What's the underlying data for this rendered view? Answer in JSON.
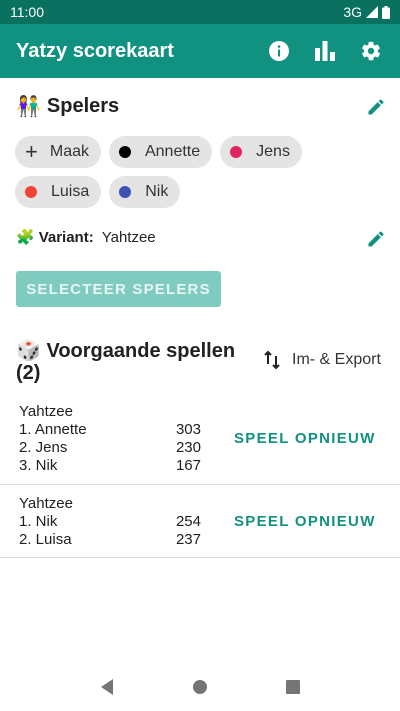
{
  "status": {
    "time": "11:00",
    "network": "3G"
  },
  "app_bar": {
    "title": "Yatzy scorekaart",
    "icons": [
      "info-icon",
      "bar-chart-icon",
      "settings-icon"
    ]
  },
  "players_section": {
    "emoji": "👫",
    "title": "Spelers",
    "add_label": "Maak",
    "players": [
      {
        "name": "Annette",
        "color": "#000000"
      },
      {
        "name": "Jens",
        "color": "#e0245e"
      },
      {
        "name": "Luisa",
        "color": "#f44336"
      },
      {
        "name": "Nik",
        "color": "#3f51b5"
      }
    ]
  },
  "variant": {
    "emoji": "🧩",
    "label": "Variant:",
    "value": "Yahtzee"
  },
  "select_button": "SELECTEER SPELERS",
  "previous": {
    "emoji": "🎲",
    "title": "Voorgaande spellen",
    "count": "(2)",
    "import_export": "Im- & Export",
    "games": [
      {
        "variant": "Yahtzee",
        "replay": "SPEEL OPNIEUW",
        "ranks": [
          {
            "label": "1. Annette",
            "score": "303"
          },
          {
            "label": "2. Jens",
            "score": "230"
          },
          {
            "label": "3. Nik",
            "score": "167"
          }
        ]
      },
      {
        "variant": "Yahtzee",
        "replay": "SPEEL OPNIEUW",
        "ranks": [
          {
            "label": "1. Nik",
            "score": "254"
          },
          {
            "label": "2. Luisa",
            "score": "237"
          }
        ]
      }
    ]
  },
  "colors": {
    "primary": "#11917f",
    "status_bar": "#0a7060",
    "button_disabled": "#7fcbc0"
  }
}
